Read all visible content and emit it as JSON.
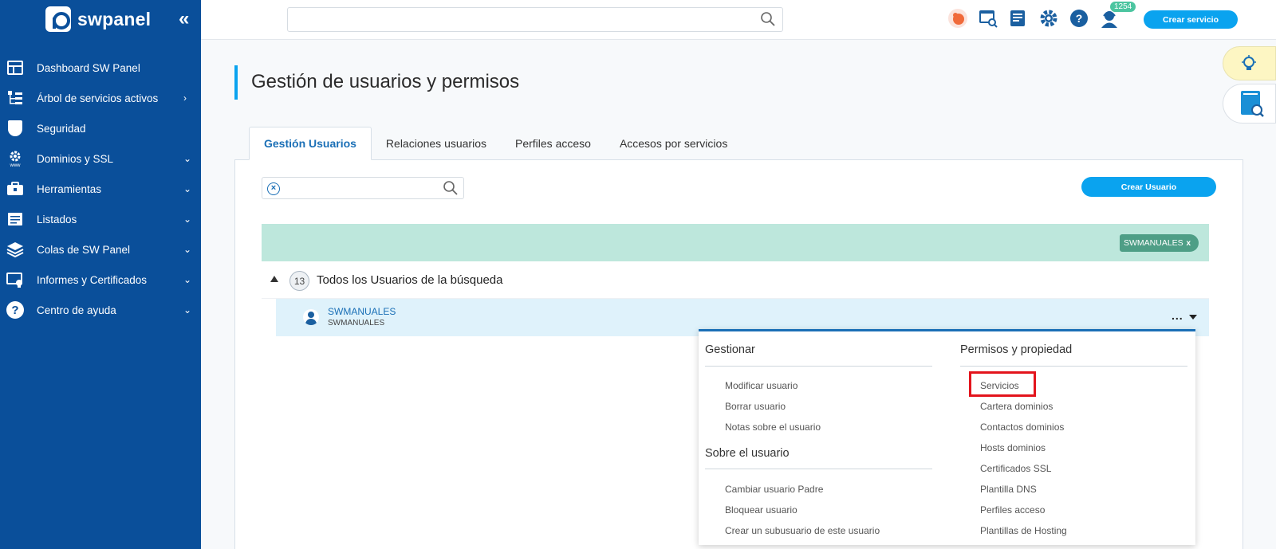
{
  "brand": {
    "name": "swpanel"
  },
  "sidebar": {
    "items": [
      {
        "label": "Dashboard SW Panel",
        "arrow": ""
      },
      {
        "label": "Árbol de servicios activos",
        "arrow": "›"
      },
      {
        "label": "Seguridad",
        "arrow": ""
      },
      {
        "label": "Dominios y SSL",
        "arrow": "⌄"
      },
      {
        "label": "Herramientas",
        "arrow": "⌄"
      },
      {
        "label": "Listados",
        "arrow": "⌄"
      },
      {
        "label": "Colas de SW Panel",
        "arrow": "⌄"
      },
      {
        "label": "Informes y Certificados",
        "arrow": "⌄"
      },
      {
        "label": "Centro de ayuda",
        "arrow": "⌄"
      }
    ]
  },
  "topbar": {
    "search_value": "",
    "notification_count": "1254",
    "crear_servicio": "Crear servicio",
    "icons": [
      "flame-icon",
      "web-search-icon",
      "invoice-icon",
      "settings-icon",
      "help-icon",
      "support-agent-icon"
    ]
  },
  "page": {
    "title": "Gestión de usuarios y permisos",
    "tabs": [
      "Gestión Usuarios",
      "Relaciones usuarios",
      "Perfiles acceso",
      "Accesos por servicios"
    ],
    "active_tab": "Gestión Usuarios"
  },
  "toolbar": {
    "filter_value": "",
    "crear_usuario": "Crear Usuario"
  },
  "filter_chip": {
    "label": "SWMANUALES",
    "close": "x"
  },
  "group": {
    "count": "13",
    "label": "Todos los Usuarios de la búsqueda"
  },
  "user": {
    "name": "SWMANUALES",
    "sub": "SWMANUALES",
    "menu": "..."
  },
  "dropdown": {
    "gestionar": {
      "heading": "Gestionar",
      "items": [
        "Modificar usuario",
        "Borrar usuario",
        "Notas sobre el usuario"
      ]
    },
    "sobre": {
      "heading": "Sobre el usuario",
      "items": [
        "Cambiar usuario Padre",
        "Bloquear usuario",
        "Crear un subusuario de este usuario"
      ]
    },
    "permisos": {
      "heading": "Permisos y propiedad",
      "items": [
        "Servicios",
        "Cartera dominios",
        "Contactos dominios",
        "Hosts dominios",
        "Certificados SSL",
        "Plantilla DNS",
        "Perfiles acceso",
        "Plantillas de Hosting"
      ]
    }
  },
  "colors": {
    "sidebar": "#0a4f9a",
    "accent": "#0aa3ef",
    "filter_band": "#bde7dc",
    "chip": "#4e9e86",
    "highlight": "#e3141c"
  }
}
